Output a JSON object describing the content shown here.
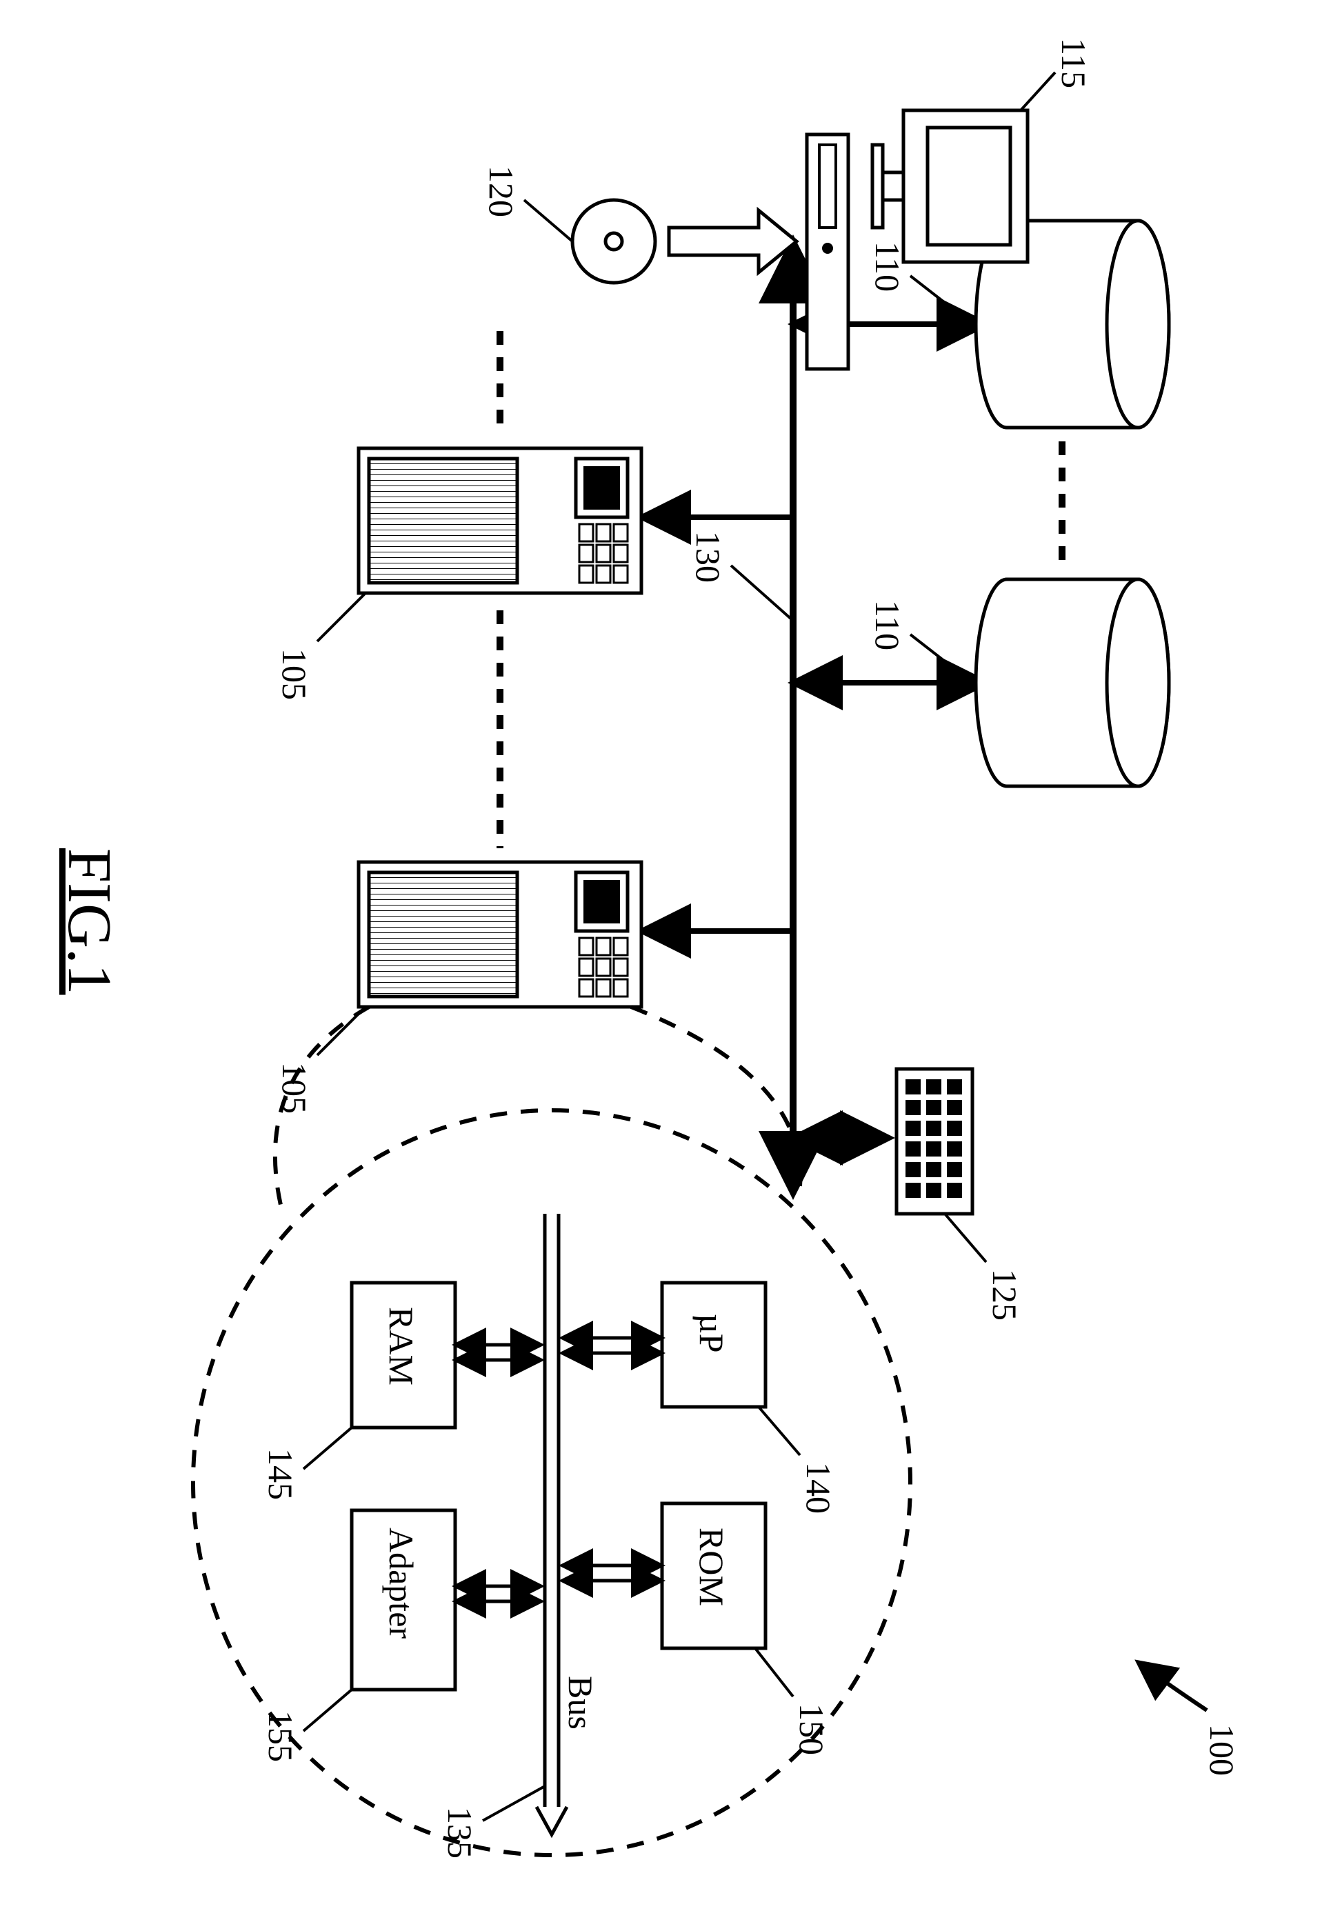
{
  "figure_ref": "100",
  "console_ref": "115",
  "media_ref": "120",
  "disk_ref_a": "110",
  "disk_ref_b": "110",
  "server_ref_a": "105",
  "server_ref_b": "105",
  "switch_ref": "125",
  "bus_label": "Bus",
  "network_ref": "130",
  "cpu_label": "µP",
  "cpu_ref": "140",
  "rom_label": "ROM",
  "rom_ref": "150",
  "ram_label": "RAM",
  "ram_ref": "145",
  "adapter_label": "Adapter",
  "adapter_ref": "155",
  "internal_bus_ref": "135",
  "figure_caption": "FIG.1"
}
